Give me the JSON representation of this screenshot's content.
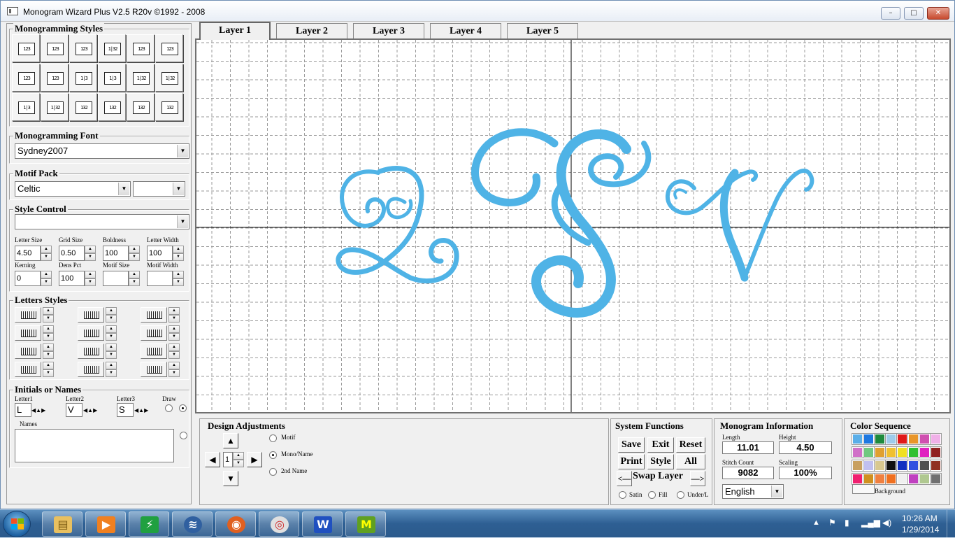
{
  "window": {
    "title": "Monogram Wizard Plus V2.5 R20v ©1992 - 2008",
    "minimize": "–",
    "maximize": "□",
    "close": "✕"
  },
  "styles_panel": {
    "title": "Monogramming Styles",
    "buttons": [
      "123",
      "123",
      "123",
      "1|32",
      "123",
      "123",
      "123",
      "123",
      "1|3",
      "1|3",
      "1|32",
      "1|32",
      "1|3",
      "1|32",
      "132",
      "132",
      "132",
      "132"
    ]
  },
  "font_panel": {
    "title": "Monogramming Font",
    "value": "Sydney2007"
  },
  "motif_panel": {
    "title": "Motif Pack",
    "value": "Celtic",
    "second_value": ""
  },
  "style_control": {
    "title": "Style Control",
    "value": "",
    "fields": [
      {
        "label": "Letter Size",
        "value": "4.50"
      },
      {
        "label": "Grid Size",
        "value": "0.50"
      },
      {
        "label": "Boldness",
        "value": "100"
      },
      {
        "label": "Letter Width",
        "value": "100"
      },
      {
        "label": "Kerning",
        "value": "0"
      },
      {
        "label": "Dens Pct",
        "value": "100"
      },
      {
        "label": "Motif Size",
        "value": ""
      },
      {
        "label": "Motif Width",
        "value": ""
      }
    ]
  },
  "letter_styles": {
    "title": "Letters Styles"
  },
  "initials": {
    "title": "Initials or Names",
    "letter1_label": "Letter1",
    "letter1": "L",
    "letter2_label": "Letter2",
    "letter2": "V",
    "letter3_label": "Letter3",
    "letter3": "S",
    "draw_label": "Draw",
    "names_label": "Names",
    "names_value": ""
  },
  "tabs": [
    "Layer 1",
    "Layer 2",
    "Layer 3",
    "Layer 4",
    "Layer 5"
  ],
  "monogram": {
    "left": "L",
    "center": "S",
    "right": "V",
    "color": "#4fb3e6"
  },
  "design_adjustments": {
    "title": "Design Adjustments",
    "step": "1",
    "options": [
      "Motif",
      "Mono/Name",
      "2nd Name"
    ],
    "selected": "Mono/Name"
  },
  "system_functions": {
    "title": "System Functions",
    "buttons": [
      "Save",
      "Exit",
      "Reset",
      "Print",
      "Style",
      "All"
    ],
    "swap_left": "<—",
    "swap_label": "Swap Layer",
    "swap_right": "—>",
    "radio_labels": [
      "Satin",
      "Fill",
      "Under/L"
    ]
  },
  "monogram_info": {
    "title": "Monogram Information",
    "length_label": "Length",
    "length": "11.01",
    "height_label": "Height",
    "height": "4.50",
    "stitch_label": "Stitch Count",
    "stitch": "9082",
    "scaling_label": "Scaling",
    "scaling": "100%",
    "language": "English"
  },
  "color_sequence": {
    "title": "Color Sequence",
    "background_label": "Background",
    "colors": [
      "#5aaee8",
      "#1e78e0",
      "#1e8a3c",
      "#9ecbea",
      "#e01818",
      "#e8962a",
      "#d050b0",
      "#f0b0e8",
      "#d070c8",
      "#70c880",
      "#e0a030",
      "#f0c030",
      "#f0e020",
      "#30c030",
      "#e020c0",
      "#902020",
      "#c8a060",
      "#c0c0f0",
      "#d8c890",
      "#101010",
      "#1030c0",
      "#3050e0",
      "#505050",
      "#903020",
      "#f02070",
      "#d09020",
      "#f08040",
      "#f07020",
      "#f0f0f0",
      "#c040c0",
      "#b0c890",
      "#707070"
    ]
  },
  "taskbar": {
    "apps": [
      "explorer-icon",
      "media-player-icon",
      "stock-chart-icon",
      "wifi-app-icon",
      "firefox-icon",
      "chrome-icon",
      "word-icon",
      "monogram-wizard-icon"
    ],
    "time": "10:26 AM",
    "date": "1/29/2014"
  }
}
